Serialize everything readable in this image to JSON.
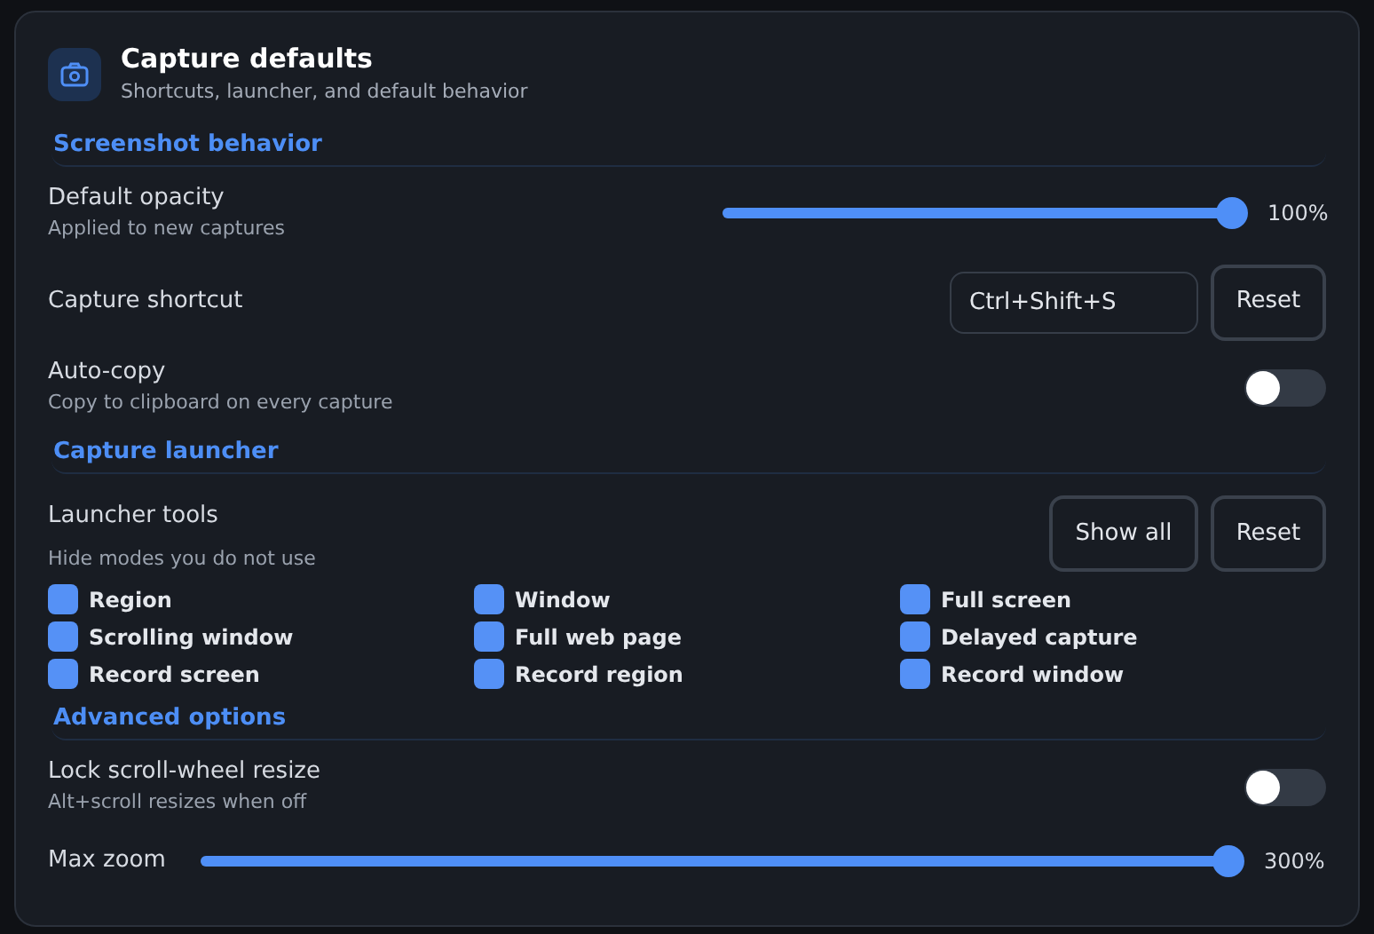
{
  "header": {
    "title": "Capture defaults",
    "subtitle": "Shortcuts, launcher, and default behavior"
  },
  "sections": [
    {
      "title": "Screenshot behavior",
      "rows": [
        {
          "kind": "slider",
          "label": "Default opacity",
          "sublabel": "Applied to new captures",
          "level": 1,
          "reading": "100%"
        },
        {
          "kind": "shortcut",
          "label": "Capture shortcut",
          "value": "Ctrl+Shift+S",
          "button": "Reset"
        },
        {
          "kind": "toggle",
          "label": "Auto-copy",
          "sublabel": "Copy to clipboard on every capture",
          "on": false
        }
      ]
    },
    {
      "title": "Capture launcher",
      "rows": [
        {
          "kind": "tools",
          "label": "Launcher tools",
          "sublabel": "Hide modes you do not use",
          "buttons": [
            "Show all",
            "Reset"
          ],
          "tools": [
            {
              "label": "Region",
              "checked": true
            },
            {
              "label": "Window",
              "checked": true
            },
            {
              "label": "Full screen",
              "checked": true
            },
            {
              "label": "Scrolling window",
              "checked": true
            },
            {
              "label": "Full web page",
              "checked": true
            },
            {
              "label": "Delayed capture",
              "checked": true
            },
            {
              "label": "Record screen",
              "checked": true
            },
            {
              "label": "Record region",
              "checked": true
            },
            {
              "label": "Record window",
              "checked": true
            }
          ]
        }
      ]
    },
    {
      "title": "Advanced options",
      "rows": [
        {
          "kind": "toggle",
          "label": "Lock scroll-wheel resize",
          "sublabel": "Alt+scroll resizes when off",
          "on": false
        },
        {
          "kind": "inline-slider",
          "label": "Max zoom",
          "level": 1,
          "reading": "300%"
        }
      ]
    }
  ]
}
